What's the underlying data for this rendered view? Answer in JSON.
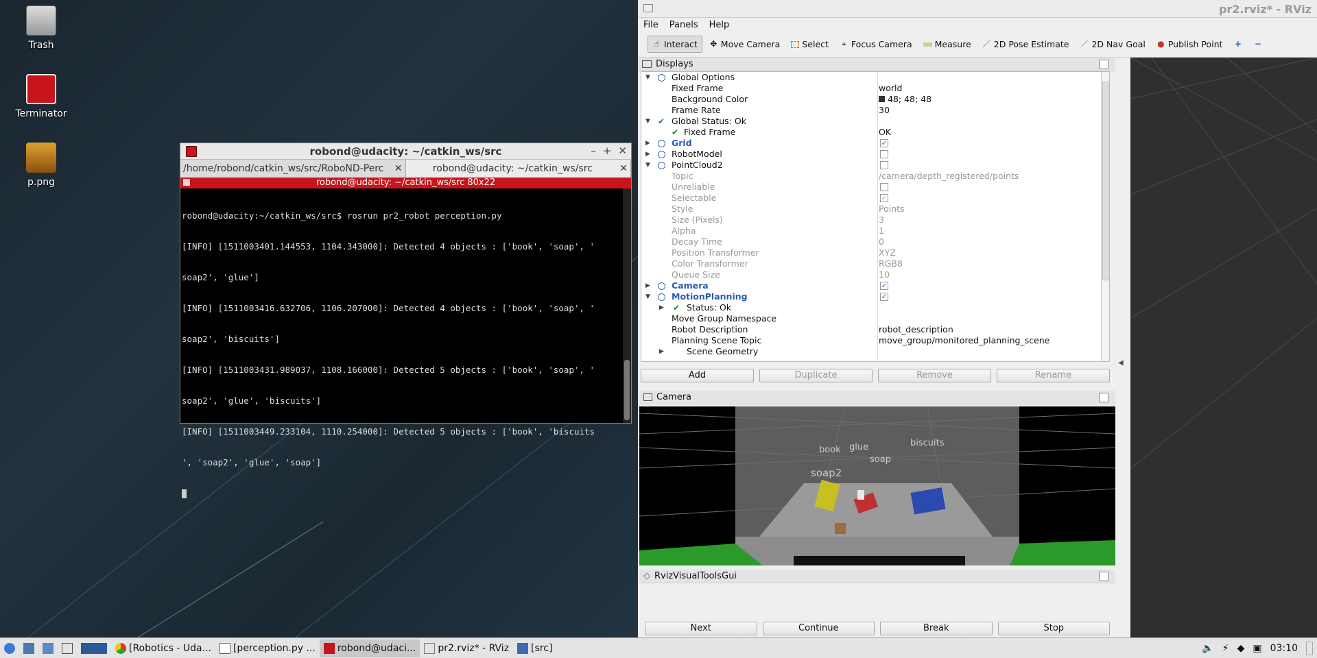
{
  "desktop": {
    "icons": [
      {
        "label": "Trash"
      },
      {
        "label": "Terminator"
      },
      {
        "label": "p.png"
      }
    ]
  },
  "terminal": {
    "title": "robond@udacity: ~/catkin_ws/src",
    "tabs": [
      {
        "label": "/home/robond/catkin_ws/src/RoboND-Perc"
      },
      {
        "label": "robond@udacity: ~/catkin_ws/src"
      }
    ],
    "bar": "robond@udacity: ~/catkin_ws/src 80x22",
    "lines": [
      "robond@udacity:~/catkin_ws/src$ rosrun pr2_robot perception.py",
      "[INFO] [1511003401.144553, 1104.343000]: Detected 4 objects : ['book', 'soap', '",
      "soap2', 'glue']",
      "[INFO] [1511003416.632706, 1106.207000]: Detected 4 objects : ['book', 'soap', '",
      "soap2', 'biscuits']",
      "[INFO] [1511003431.989037, 1108.166000]: Detected 5 objects : ['book', 'soap', '",
      "soap2', 'glue', 'biscuits']",
      "[INFO] [1511003449.233104, 1110.254000]: Detected 5 objects : ['book', 'biscuits",
      "', 'soap2', 'glue', 'soap']"
    ]
  },
  "rviz": {
    "title": "pr2.rviz* - RViz",
    "menu": [
      "File",
      "Panels",
      "Help"
    ],
    "toolbar": [
      "Interact",
      "Move Camera",
      "Select",
      "Focus Camera",
      "Measure",
      "2D Pose Estimate",
      "2D Nav Goal",
      "Publish Point"
    ],
    "displays_title": "Displays",
    "tree": [
      {
        "k": "Global Options",
        "v": "",
        "lvl": 0,
        "arrow": "▼",
        "style": ""
      },
      {
        "k": "Fixed Frame",
        "v": "world",
        "lvl": 1,
        "arrow": "",
        "style": ""
      },
      {
        "k": "Background Color",
        "v": "48; 48; 48",
        "lvl": 1,
        "arrow": "",
        "style": "",
        "swatch": "#303030"
      },
      {
        "k": "Frame Rate",
        "v": "30",
        "lvl": 1,
        "arrow": "",
        "style": ""
      },
      {
        "k": "Global Status: Ok",
        "v": "",
        "lvl": 0,
        "arrow": "▼",
        "style": "",
        "check": true
      },
      {
        "k": "Fixed Frame",
        "v": "OK",
        "lvl": 1,
        "arrow": "",
        "style": "",
        "check": true
      },
      {
        "k": "Grid",
        "v": "",
        "lvl": 0,
        "arrow": "▶",
        "style": "blue",
        "box": "on"
      },
      {
        "k": "RobotModel",
        "v": "",
        "lvl": 0,
        "arrow": "▶",
        "style": "",
        "box": "off"
      },
      {
        "k": "PointCloud2",
        "v": "",
        "lvl": 0,
        "arrow": "▼",
        "style": "",
        "box": "off"
      },
      {
        "k": "Topic",
        "v": "/camera/depth_registered/points",
        "lvl": 1,
        "arrow": "",
        "style": "dim"
      },
      {
        "k": "Unreliable",
        "v": "",
        "lvl": 1,
        "arrow": "",
        "style": "dim",
        "box": "off"
      },
      {
        "k": "Selectable",
        "v": "",
        "lvl": 1,
        "arrow": "",
        "style": "dim",
        "box": "on"
      },
      {
        "k": "Style",
        "v": "Points",
        "lvl": 1,
        "arrow": "",
        "style": "dim"
      },
      {
        "k": "Size (Pixels)",
        "v": "3",
        "lvl": 1,
        "arrow": "",
        "style": "dim"
      },
      {
        "k": "Alpha",
        "v": "1",
        "lvl": 1,
        "arrow": "",
        "style": "dim"
      },
      {
        "k": "Decay Time",
        "v": "0",
        "lvl": 1,
        "arrow": "",
        "style": "dim"
      },
      {
        "k": "Position Transformer",
        "v": "XYZ",
        "lvl": 1,
        "arrow": "",
        "style": "dim"
      },
      {
        "k": "Color Transformer",
        "v": "RGB8",
        "lvl": 1,
        "arrow": "",
        "style": "dim"
      },
      {
        "k": "Queue Size",
        "v": "10",
        "lvl": 1,
        "arrow": "",
        "style": "dim"
      },
      {
        "k": "Camera",
        "v": "",
        "lvl": 0,
        "arrow": "▶",
        "style": "blue",
        "box": "on"
      },
      {
        "k": "MotionPlanning",
        "v": "",
        "lvl": 0,
        "arrow": "▼",
        "style": "blue",
        "box": "on"
      },
      {
        "k": "Status: Ok",
        "v": "",
        "lvl": 2,
        "arrow": "▶",
        "style": "",
        "check": true
      },
      {
        "k": "Move Group Namespace",
        "v": "",
        "lvl": 1,
        "arrow": "",
        "style": ""
      },
      {
        "k": "Robot Description",
        "v": "robot_description",
        "lvl": 1,
        "arrow": "",
        "style": ""
      },
      {
        "k": "Planning Scene Topic",
        "v": "move_group/monitored_planning_scene",
        "lvl": 1,
        "arrow": "",
        "style": ""
      },
      {
        "k": "Scene Geometry",
        "v": "",
        "lvl": 2,
        "arrow": "▶",
        "style": ""
      }
    ],
    "display_buttons": [
      {
        "label": "Add",
        "dis": false
      },
      {
        "label": "Duplicate",
        "dis": true
      },
      {
        "label": "Remove",
        "dis": true
      },
      {
        "label": "Rename",
        "dis": true
      }
    ],
    "camera_title": "Camera",
    "camera_labels": [
      "book",
      "glue",
      "soap",
      "biscuits",
      "soap2"
    ],
    "visual_tools_title": "RvizVisualToolsGui",
    "bottom_buttons": [
      "Next",
      "Continue",
      "Break",
      "Stop"
    ]
  },
  "taskbar": {
    "items": [
      "[Robotics - Uda...",
      "[perception.py ...",
      "robond@udaci...",
      "pr2.rviz* - RViz",
      "[src]"
    ],
    "clock": "03:10"
  }
}
